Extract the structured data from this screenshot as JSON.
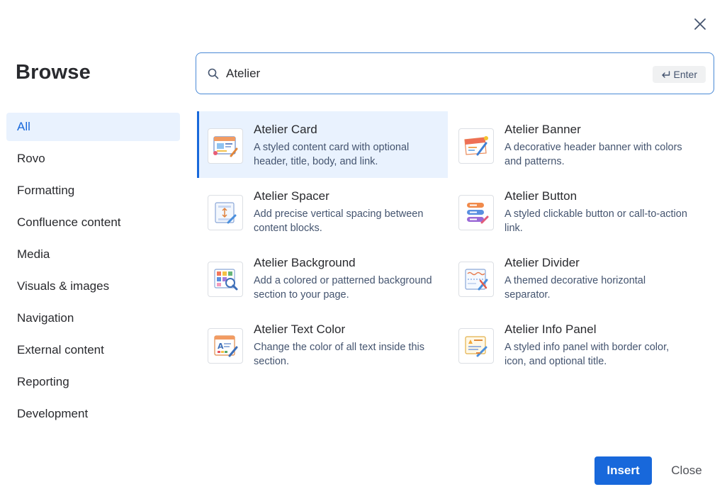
{
  "header": {
    "title": "Browse",
    "close_icon": "close-icon"
  },
  "search": {
    "value": "Atelier",
    "placeholder": "",
    "enter_label": "Enter"
  },
  "nav": {
    "items": [
      {
        "label": "All",
        "active": true
      },
      {
        "label": "Rovo"
      },
      {
        "label": "Formatting"
      },
      {
        "label": "Confluence content"
      },
      {
        "label": "Media"
      },
      {
        "label": "Visuals & images"
      },
      {
        "label": "Navigation"
      },
      {
        "label": "External content"
      },
      {
        "label": "Reporting"
      },
      {
        "label": "Development"
      }
    ]
  },
  "results": [
    {
      "title": "Atelier Card",
      "description": "A styled content card with optional header, title, body, and link.",
      "selected": true,
      "icon": "card-icon"
    },
    {
      "title": "Atelier Banner",
      "description": "A decorative header banner with colors and patterns.",
      "icon": "banner-icon"
    },
    {
      "title": "Atelier Spacer",
      "description": "Add precise vertical spacing between content blocks.",
      "icon": "spacer-icon"
    },
    {
      "title": "Atelier Button",
      "description": "A styled clickable button or call-to-action link.",
      "icon": "button-icon"
    },
    {
      "title": "Atelier Background",
      "description": "Add a colored or patterned background section to your page.",
      "icon": "background-icon"
    },
    {
      "title": "Atelier Divider",
      "description": "A themed decorative horizontal separator.",
      "icon": "divider-icon"
    },
    {
      "title": "Atelier Text Color",
      "description": "Change the color of all text inside this section.",
      "icon": "text-color-icon"
    },
    {
      "title": "Atelier Info Panel",
      "description": "A styled info panel with border color, icon, and optional title.",
      "icon": "info-panel-icon"
    }
  ],
  "footer": {
    "insert_label": "Insert",
    "close_label": "Close"
  },
  "colors": {
    "accent": "#1868db",
    "selected_bg": "#e9f2fe",
    "text": "#292a2e",
    "muted": "#44546f"
  }
}
